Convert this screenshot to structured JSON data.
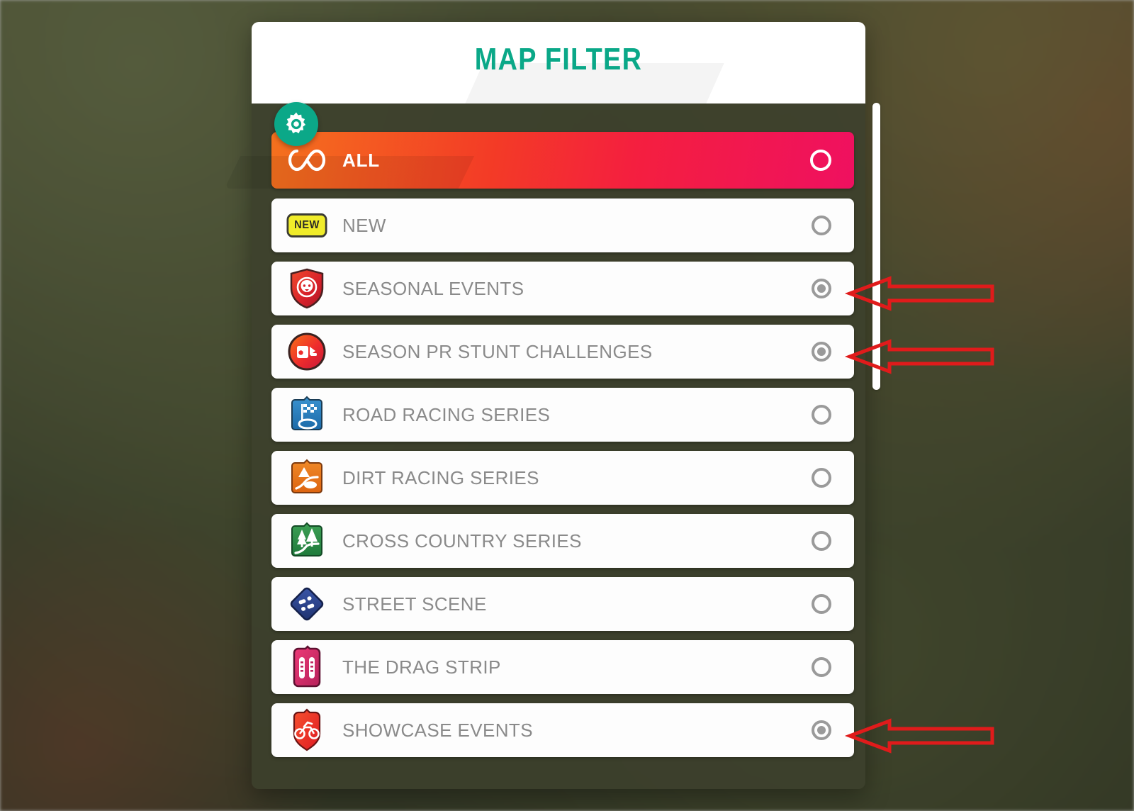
{
  "window": {
    "title": "MAP FILTER",
    "gear_icon": "gear-icon",
    "accent_color": "#0aa888",
    "panel_color": "#3c402c"
  },
  "scrollbar": {
    "orientation": "vertical",
    "visible": true
  },
  "filter_list": {
    "items": [
      {
        "label": "ALL",
        "icon": "infinity-icon",
        "icon_style": "gradient-bar",
        "selected": true,
        "highlighted": true,
        "badge": null
      },
      {
        "label": "NEW",
        "icon": "new-badge-icon",
        "icon_style": "yellow-badge",
        "selected": false,
        "highlighted": false,
        "badge": "NEW"
      },
      {
        "label": "SEASONAL EVENTS",
        "icon": "lion-shield-icon",
        "icon_style": "red-shield",
        "selected": true,
        "highlighted": false,
        "badge": null
      },
      {
        "label": "SEASON PR STUNT CHALLENGES",
        "icon": "speedometer-circle-icon",
        "icon_style": "red-circle",
        "selected": true,
        "highlighted": false,
        "badge": null
      },
      {
        "label": "ROAD RACING SERIES",
        "icon": "checkered-flag-road-icon",
        "icon_style": "blue-square",
        "selected": false,
        "highlighted": false,
        "badge": null
      },
      {
        "label": "DIRT RACING SERIES",
        "icon": "dirt-trail-icon",
        "icon_style": "orange-square",
        "selected": false,
        "highlighted": false,
        "badge": null
      },
      {
        "label": "CROSS COUNTRY SERIES",
        "icon": "pine-trees-icon",
        "icon_style": "green-square",
        "selected": false,
        "highlighted": false,
        "badge": null
      },
      {
        "label": "STREET SCENE",
        "icon": "street-diamond-icon",
        "icon_style": "blue-diamond",
        "selected": false,
        "highlighted": false,
        "badge": null
      },
      {
        "label": "THE DRAG STRIP",
        "icon": "drag-lanes-icon",
        "icon_style": "pink-shield",
        "selected": false,
        "highlighted": false,
        "badge": null
      },
      {
        "label": "SHOWCASE EVENTS",
        "icon": "motorcycle-shield-icon",
        "icon_style": "red-shield",
        "selected": true,
        "highlighted": false,
        "badge": null
      }
    ]
  },
  "annotations": {
    "color": "#e01b1b",
    "arrows": [
      {
        "name": "arrow-seasonal-events",
        "points_to": "SEASONAL EVENTS"
      },
      {
        "name": "arrow-season-pr-stunt",
        "points_to": "SEASON PR STUNT CHALLENGES"
      },
      {
        "name": "arrow-showcase-events",
        "points_to": "SHOWCASE EVENTS"
      }
    ]
  }
}
